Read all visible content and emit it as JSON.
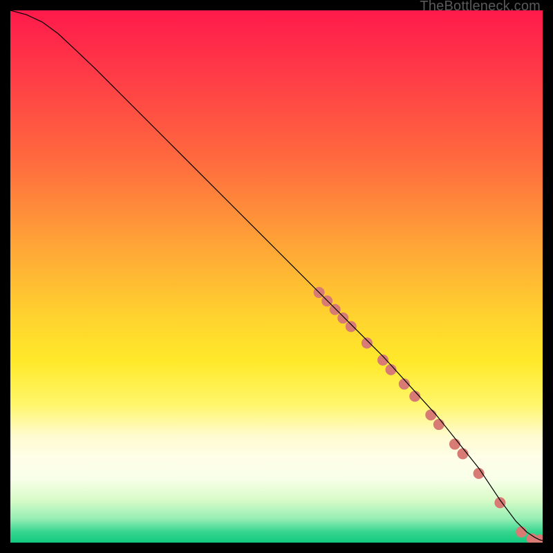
{
  "watermark": "TheBottleneck.com",
  "chart_data": {
    "type": "line",
    "title": "",
    "xlabel": "",
    "ylabel": "",
    "xlim": [
      0,
      100
    ],
    "ylim": [
      0,
      100
    ],
    "background_gradient": {
      "top": "#ff1a4b",
      "middle": "#ffe92a",
      "bottom": "#12c97d"
    },
    "series": [
      {
        "name": "curve",
        "color": "#000000",
        "x": [
          0,
          3,
          6,
          9,
          12,
          16,
          20,
          30,
          40,
          50,
          60,
          70,
          80,
          88,
          92,
          95,
          97,
          98.5,
          99.5,
          100
        ],
        "y": [
          100,
          99.2,
          97.8,
          95.6,
          92.8,
          89,
          85,
          75,
          65,
          55,
          45,
          35,
          24,
          14,
          8,
          4,
          2,
          1,
          0.5,
          0.4
        ]
      }
    ],
    "markers": {
      "color": "#d77b74",
      "radius": 8,
      "points": [
        {
          "x": 58,
          "y": 47
        },
        {
          "x": 59.5,
          "y": 45.4
        },
        {
          "x": 61,
          "y": 43.8
        },
        {
          "x": 62.5,
          "y": 42.2
        },
        {
          "x": 64,
          "y": 40.6
        },
        {
          "x": 67,
          "y": 37.5
        },
        {
          "x": 70,
          "y": 34.3
        },
        {
          "x": 71.5,
          "y": 32.5
        },
        {
          "x": 74,
          "y": 29.8
        },
        {
          "x": 76,
          "y": 27.5
        },
        {
          "x": 79,
          "y": 24
        },
        {
          "x": 80.5,
          "y": 22.2
        },
        {
          "x": 83.5,
          "y": 18.5
        },
        {
          "x": 85,
          "y": 16.7
        },
        {
          "x": 88,
          "y": 13
        },
        {
          "x": 92,
          "y": 7.5
        },
        {
          "x": 96,
          "y": 2
        },
        {
          "x": 98,
          "y": 0.7
        },
        {
          "x": 99.5,
          "y": 0.5
        }
      ]
    }
  }
}
